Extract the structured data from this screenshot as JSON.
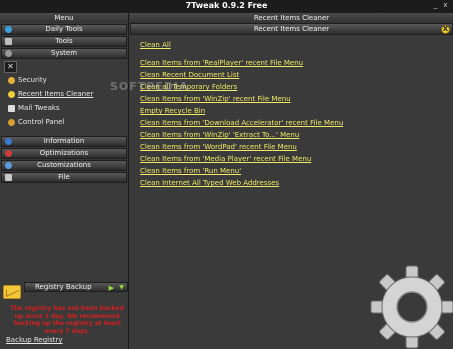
{
  "window": {
    "title": "7Tweak 0.9.2 Free",
    "controls": [
      "_",
      "x"
    ]
  },
  "sidebar": {
    "menu_header": "Menu",
    "top_categories": [
      {
        "label": "Daily Tools",
        "icon": "circle-icon"
      },
      {
        "label": "Tools",
        "icon": "wrench-icon"
      },
      {
        "label": "System",
        "icon": "gear-icon"
      }
    ],
    "system_items": [
      {
        "label": "Security",
        "icon": "shield-icon",
        "active": false
      },
      {
        "label": "Recent Items Cleaner",
        "icon": "cleaner-icon",
        "active": true
      },
      {
        "label": "Mail Tweaks",
        "icon": "mail-icon",
        "active": false
      },
      {
        "label": "Control Panel",
        "icon": "control-panel-icon",
        "active": false
      }
    ],
    "bottom_categories": [
      {
        "label": "Information",
        "icon": "info-icon"
      },
      {
        "label": "Optimizations",
        "icon": "speed-icon"
      },
      {
        "label": "Customizations",
        "icon": "paint-icon"
      },
      {
        "label": "File",
        "icon": "file-icon"
      }
    ]
  },
  "registry": {
    "title": "Registry Backup",
    "message": "The registry has not been backed up since 1 day. We recommend backing up the registry at least every 7 days.",
    "link": "Backup Registry"
  },
  "main": {
    "header": "Recent Items Cleaner",
    "subheader": "Recent Items Cleaner",
    "close": "X",
    "links": [
      "Clean All",
      "Clean Items from 'RealPlayer' recent File Menu",
      "Clean Recent Document List",
      "Clean all Temporary Folders",
      "Clean Items from 'WinZip' recent File Menu",
      "Empty Recycle Bin",
      "Clean Items from 'Download Accelerator' recent File Menu",
      "Clean Items from 'WinZip' 'Extract To...' Menu",
      "Clean Items from 'WordPad' recent File Menu",
      "Clean Items from 'Media Player' recent File Menu",
      "Clean Items from 'Run Menu'",
      "Clean Internet All Typed Web Addresses"
    ]
  },
  "watermark": "SOFTPEDIA",
  "colors": {
    "link": "#f2ea66",
    "warning": "#d22020",
    "accent": "#f0d03a",
    "play": "#9bdc3a"
  }
}
